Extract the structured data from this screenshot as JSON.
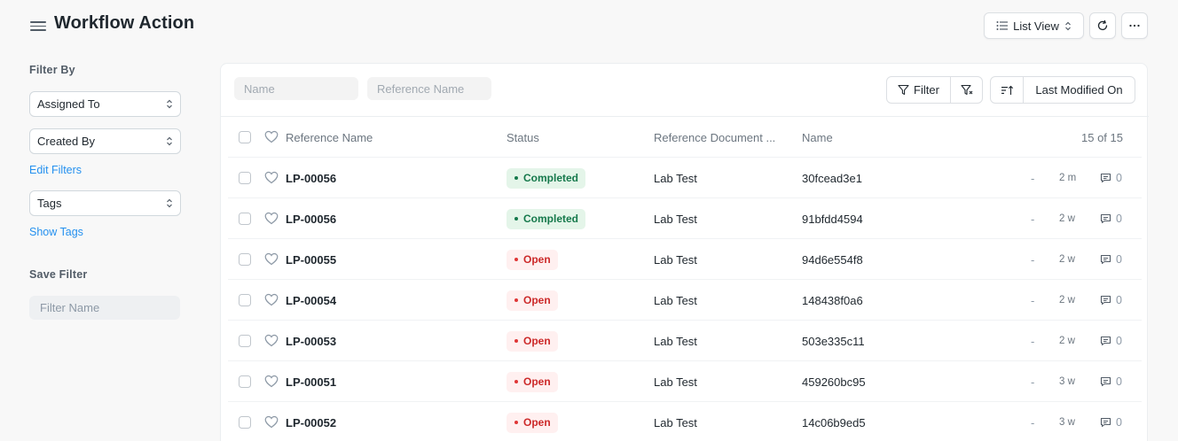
{
  "header": {
    "title": "Workflow Action",
    "list_view_label": "List View"
  },
  "sidebar": {
    "filter_by_label": "Filter By",
    "assigned_to_label": "Assigned To",
    "created_by_label": "Created By",
    "edit_filters_label": "Edit Filters",
    "tags_label": "Tags",
    "show_tags_label": "Show Tags",
    "save_filter_label": "Save Filter",
    "filter_name_placeholder": "Filter Name"
  },
  "toolbar": {
    "name_placeholder": "Name",
    "reference_name_placeholder": "Reference Name",
    "filter_label": "Filter",
    "sort_label": "Last Modified On"
  },
  "table": {
    "columns": {
      "reference_name": "Reference Name",
      "status": "Status",
      "reference_document": "Reference Document ...",
      "name": "Name"
    },
    "count_label": "15 of 15",
    "rows": [
      {
        "reference_name": "LP-00056",
        "status": "Completed",
        "status_kind": "completed",
        "reference_document": "Lab Test",
        "name": "30fcead3e1",
        "dash": "-",
        "modified": "2 m",
        "comments": "0"
      },
      {
        "reference_name": "LP-00056",
        "status": "Completed",
        "status_kind": "completed",
        "reference_document": "Lab Test",
        "name": "91bfdd4594",
        "dash": "-",
        "modified": "2 w",
        "comments": "0"
      },
      {
        "reference_name": "LP-00055",
        "status": "Open",
        "status_kind": "open",
        "reference_document": "Lab Test",
        "name": "94d6e554f8",
        "dash": "-",
        "modified": "2 w",
        "comments": "0"
      },
      {
        "reference_name": "LP-00054",
        "status": "Open",
        "status_kind": "open",
        "reference_document": "Lab Test",
        "name": "148438f0a6",
        "dash": "-",
        "modified": "2 w",
        "comments": "0"
      },
      {
        "reference_name": "LP-00053",
        "status": "Open",
        "status_kind": "open",
        "reference_document": "Lab Test",
        "name": "503e335c11",
        "dash": "-",
        "modified": "2 w",
        "comments": "0"
      },
      {
        "reference_name": "LP-00051",
        "status": "Open",
        "status_kind": "open",
        "reference_document": "Lab Test",
        "name": "459260bc95",
        "dash": "-",
        "modified": "3 w",
        "comments": "0"
      },
      {
        "reference_name": "LP-00052",
        "status": "Open",
        "status_kind": "open",
        "reference_document": "Lab Test",
        "name": "14c06b9ed5",
        "dash": "-",
        "modified": "3 w",
        "comments": "0"
      }
    ]
  },
  "colors": {
    "accent_link": "#2490ef",
    "completed_bg": "#e4f5e9",
    "completed_text": "#16794c",
    "open_bg": "#fff0f0",
    "open_text": "#cc2929"
  }
}
